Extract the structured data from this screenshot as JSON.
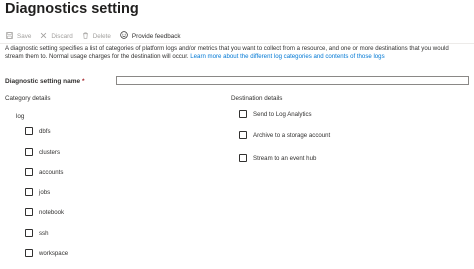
{
  "header": {
    "title": "Diagnostics setting"
  },
  "toolbar": {
    "save_label": "Save",
    "discard_label": "Discard",
    "delete_label": "Delete",
    "feedback_label": "Provide feedback"
  },
  "description": {
    "text": "A diagnostic setting specifies a list of categories of platform logs and/or metrics that you want to collect from a resource, and one or more destinations that you would stream them to. Normal usage charges for the destination will occur. ",
    "link_text": "Learn more about the different log categories and contents of those logs"
  },
  "setting_name": {
    "label": "Diagnostic setting name",
    "required_mark": "*",
    "value": ""
  },
  "category_details": {
    "heading": "Category details",
    "group_label": "log",
    "items": [
      {
        "label": "dbfs",
        "checked": false
      },
      {
        "label": "clusters",
        "checked": false
      },
      {
        "label": "accounts",
        "checked": false
      },
      {
        "label": "jobs",
        "checked": false
      },
      {
        "label": "notebook",
        "checked": false
      },
      {
        "label": "ssh",
        "checked": false
      },
      {
        "label": "workspace",
        "checked": false
      }
    ]
  },
  "destination_details": {
    "heading": "Destination details",
    "items": [
      {
        "label": "Send to Log Analytics",
        "checked": false
      },
      {
        "label": "Archive to a storage account",
        "checked": false
      },
      {
        "label": "Stream to an event hub",
        "checked": false
      }
    ]
  },
  "colors": {
    "accent": "#0078d4",
    "disabled": "#a19f9d",
    "required": "#a4262c"
  },
  "icons": {
    "save": "save-icon",
    "discard": "discard-icon",
    "delete": "delete-icon",
    "feedback": "smiley-icon"
  }
}
